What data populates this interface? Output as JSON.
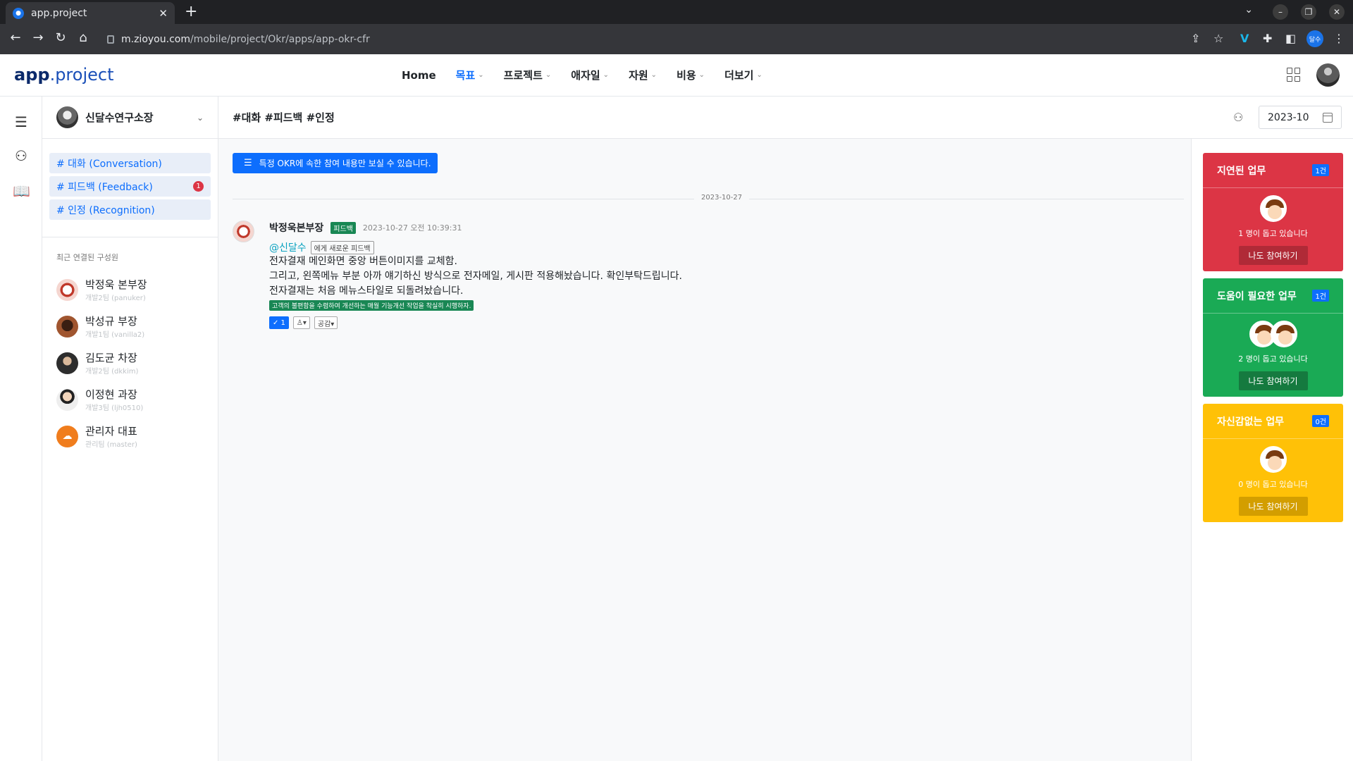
{
  "browser": {
    "tab_title": "app.project",
    "url_host": "m.zioyou.com",
    "url_path": "/mobile/project/Okr/apps/app-okr-cfr",
    "profile_label": "달수"
  },
  "app": {
    "logo_bold": "app",
    "logo_rest": ".project",
    "nav": [
      {
        "label": "Home",
        "has_caret": false
      },
      {
        "label": "목표",
        "has_caret": true,
        "active": true
      },
      {
        "label": "프로젝트",
        "has_caret": true
      },
      {
        "label": "애자일",
        "has_caret": true
      },
      {
        "label": "자원",
        "has_caret": true
      },
      {
        "label": "비용",
        "has_caret": true
      },
      {
        "label": "더보기",
        "has_caret": true
      }
    ]
  },
  "sidebar": {
    "workspace_name": "신달수연구소장",
    "channels": [
      {
        "label": "# 대화 (Conversation)",
        "badge": ""
      },
      {
        "label": "# 피드백 (Feedback)",
        "badge": "1"
      },
      {
        "label": "# 인정 (Recognition)",
        "badge": ""
      }
    ],
    "members_title": "최근 연결된 구성원",
    "members": [
      {
        "name": "박정욱 본부장",
        "sub": "개발2팀 (panuker)"
      },
      {
        "name": "박성규 부장",
        "sub": "개발1팀 (vanilla2)"
      },
      {
        "name": "김도균 차장",
        "sub": "개발2팀 (dkkim)"
      },
      {
        "name": "이정현 과장",
        "sub": "개발3팀 (ljh0510)"
      },
      {
        "name": "관리자 대표",
        "sub": "관리팀 (master)"
      }
    ]
  },
  "main": {
    "hashtags": "#대화 #피드백 #인정",
    "month": "2023-10",
    "notice": "특정 OKR에 속한 참여 내용만 보실 수 있습니다.",
    "date_separator": "2023-10-27",
    "post": {
      "author": "박정욱본부장",
      "tag": "피드백",
      "time": "2023-10-27 오전 10:39:31",
      "mention": "@신달수",
      "feedback_chip": "에게 새로운 피드백",
      "lines": [
        "전자결재 메인화면 중앙 버튼이미지를 교체함.",
        "그리고, 왼쪽메뉴 부분 아까 얘기하신 방식으로 전자메일, 게시판 적용해놨습니다. 확인부탁드립니다.",
        "전자결재는 처음 메뉴스타일로 되돌려놨습니다."
      ],
      "okr_chip": "고객의 불편함을 수렴하여 개선하는 매월 기능개선 작업을 착실히 시행하자.",
      "reaction_check": "✓ 1",
      "reaction_person": "♙▾",
      "reaction_like": "공감▾"
    }
  },
  "cards": [
    {
      "title": "지연된 업무",
      "count": "1건",
      "message": "1 명이 돕고 있습니다",
      "button": "나도 참여하기",
      "color": "#dc3545",
      "btn_color": "#b02a37"
    },
    {
      "title": "도움이 필요한 업무",
      "count": "1건",
      "message": "2 명이 돕고 있습니다",
      "button": "나도 참여하기",
      "color": "#1aaa55",
      "btn_color": "#157a3f"
    },
    {
      "title": "자신감없는 업무",
      "count": "0건",
      "message": "0 명이 돕고 있습니다",
      "button": "나도 참여하기",
      "color": "#ffc107",
      "btn_color": "#d39e00"
    }
  ]
}
